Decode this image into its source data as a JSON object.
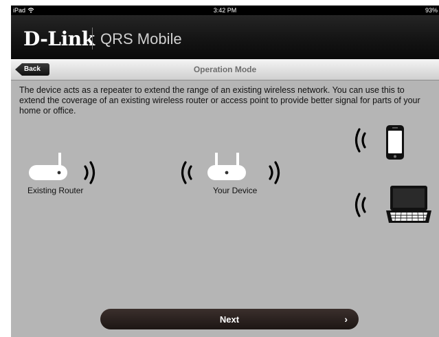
{
  "status_bar": {
    "device": "iPad",
    "wifi_icon": "wifi-icon",
    "time": "3:42 PM",
    "battery": "93%"
  },
  "brand": {
    "logo": "D-Link",
    "product": "QRS Mobile"
  },
  "nav": {
    "back_label": "Back",
    "title": "Operation Mode"
  },
  "description": "The device acts as a repeater to extend the range of an existing wireless network. You can use this to extend the coverage of an existing wireless router or access point to provide better signal for parts of your home or office.",
  "diagram": {
    "existing_router_label": "Existing Router",
    "your_device_label": "Your Device",
    "icons": [
      "router-icon",
      "wifi-signal-icon",
      "phone-icon",
      "laptop-icon"
    ]
  },
  "footer": {
    "next_label": "Next",
    "chevron": "›"
  },
  "colors": {
    "background": "#b5b5b5",
    "header": "#141414",
    "button": "#2b2220"
  }
}
